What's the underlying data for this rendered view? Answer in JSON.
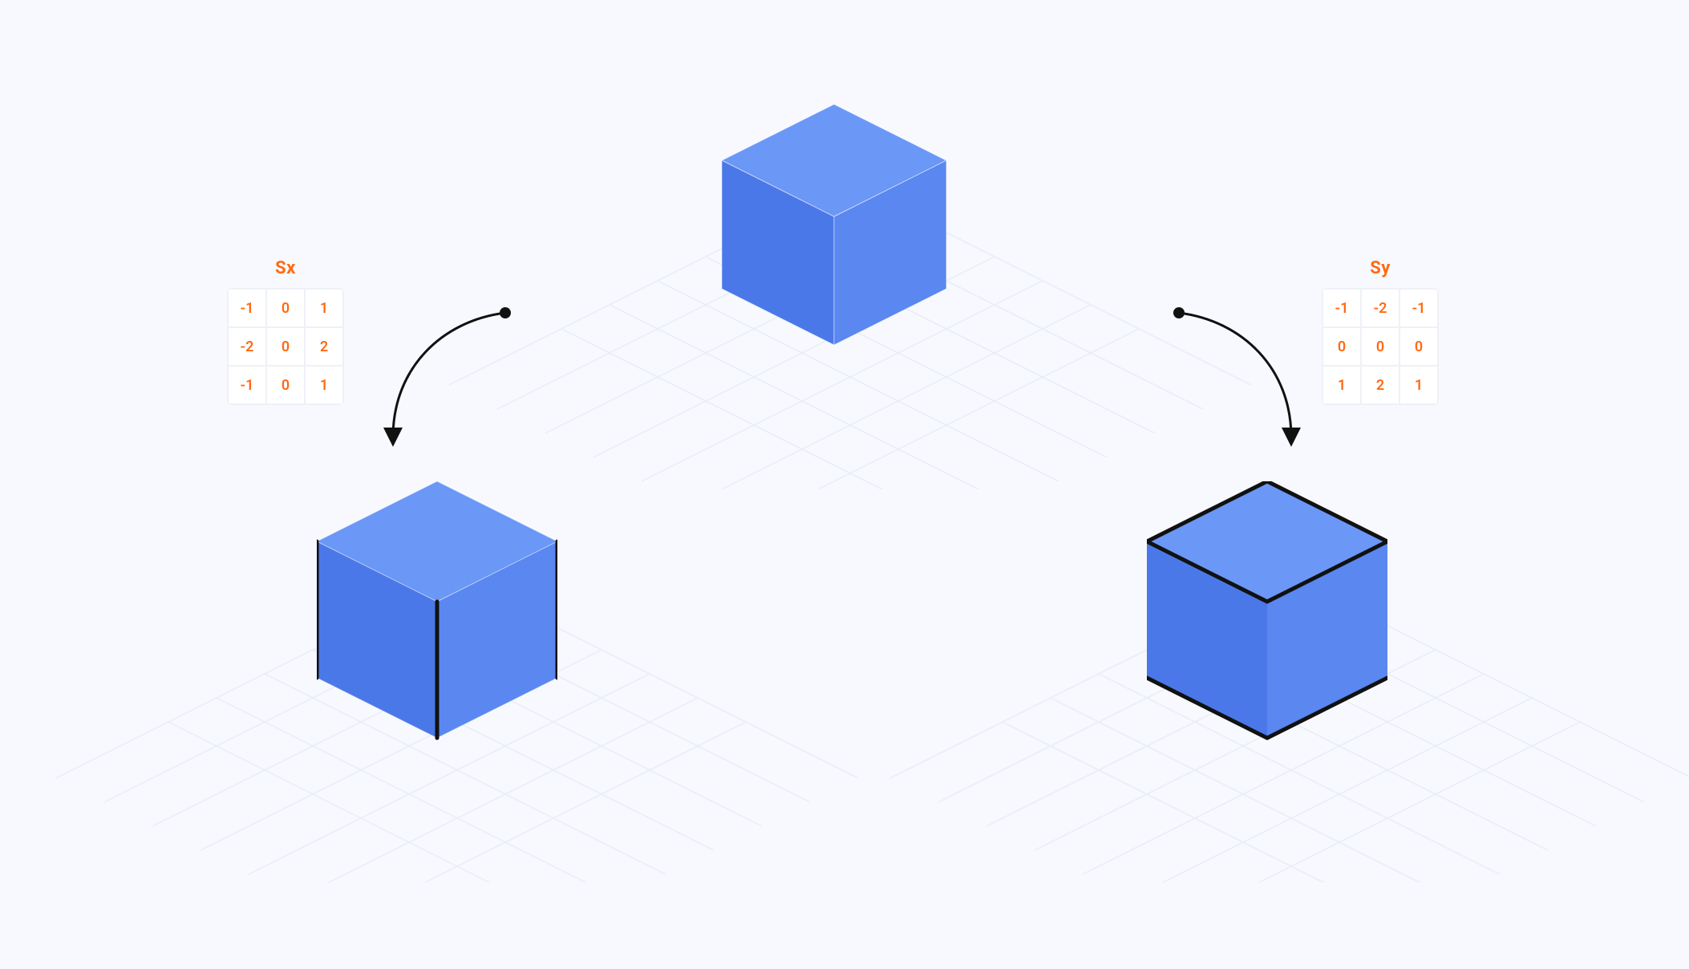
{
  "kernels": {
    "sx": {
      "label": "Sx",
      "values": [
        [
          -1,
          0,
          1
        ],
        [
          -2,
          0,
          2
        ],
        [
          -1,
          0,
          1
        ]
      ]
    },
    "sy": {
      "label": "Sy",
      "values": [
        [
          -1,
          -2,
          -1
        ],
        [
          0,
          0,
          0
        ],
        [
          1,
          2,
          1
        ]
      ]
    }
  },
  "colors": {
    "accent": "#ff6a13",
    "cube_top": "#6b97f6",
    "cube_left": "#4b78e8",
    "cube_right": "#5a87f0",
    "grid_line": "#e9edf5",
    "edge_black": "#111111"
  }
}
